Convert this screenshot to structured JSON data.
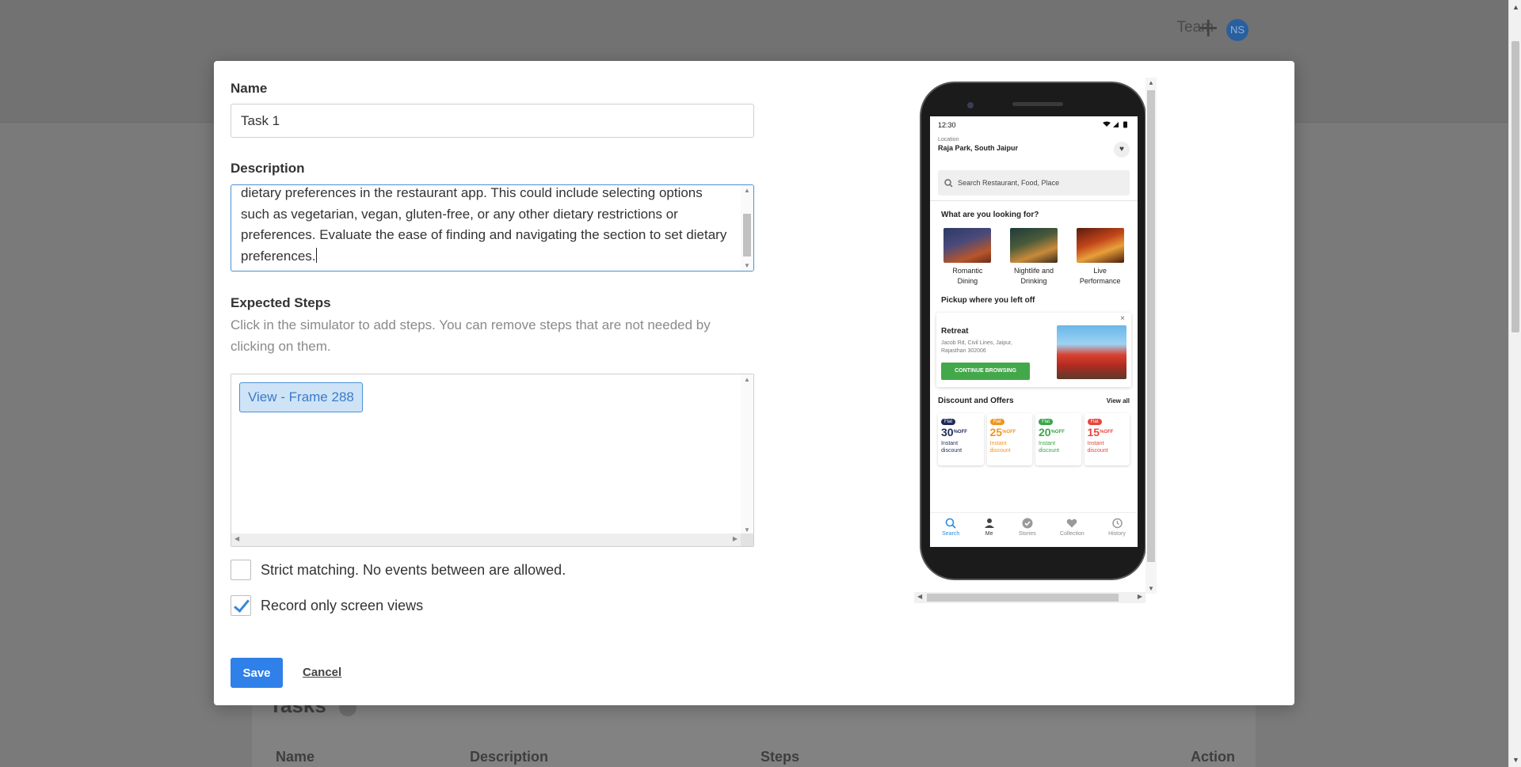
{
  "background": {
    "header": {
      "team_label": "Team",
      "plus_symbol": "+",
      "avatar_initials": "NS"
    },
    "tasks": {
      "title": "Tasks",
      "columns": [
        "Name",
        "Description",
        "Steps",
        "Action"
      ]
    }
  },
  "modal": {
    "name_label": "Name",
    "name_value": "Task 1",
    "description_label": "Description",
    "description_visible_text": "dietary preferences in the restaurant app. This could include selecting options such as vegetarian, vegan, gluten-free, or any other dietary restrictions or preferences. Evaluate the ease of finding and navigating the section to set dietary preferences.",
    "steps_label": "Expected Steps",
    "steps_hint": "Click in the simulator to add steps. You can remove steps that are not needed by clicking on them.",
    "steps": [
      "View - Frame 288"
    ],
    "strict_label": "Strict matching. No events between are allowed.",
    "strict_checked": false,
    "record_label": "Record only screen views",
    "record_checked": true,
    "save_label": "Save",
    "cancel_label": "Cancel"
  },
  "simulator": {
    "status_time": "12:30",
    "location_caption": "Location",
    "location_name": "Raja Park, South Jaipur",
    "search_placeholder": "Search Restaurant, Food, Place",
    "looking_for_title": "What are you looking for?",
    "categories": [
      {
        "label_line1": "Romantic",
        "label_line2": "Dining"
      },
      {
        "label_line1": "Nightlife and",
        "label_line2": "Drinking"
      },
      {
        "label_line1": "Live",
        "label_line2": "Performance"
      }
    ],
    "pickup_title": "Pickup where you left off",
    "pickup": {
      "close": "×",
      "name": "Retreat",
      "address_line1": "Jacob Rd, Civil Lines, Jaipur,",
      "address_line2": "Rajasthan 302006",
      "button": "CONTINUE BROWSING"
    },
    "offers_title": "Discount and Offers",
    "view_all": "View all",
    "offers": [
      {
        "flat": "Flat",
        "value": "30",
        "pct": "%",
        "off": "OFF",
        "line1": "Instant",
        "line2": "discount",
        "color": "#1f2a5a"
      },
      {
        "flat": "Flat",
        "value": "25",
        "pct": "%",
        "off": "OFF",
        "line1": "Instant",
        "line2": "discount",
        "color": "#f0961e"
      },
      {
        "flat": "Flat",
        "value": "20",
        "pct": "%",
        "off": "OFF",
        "line1": "Instant",
        "line2": "discount",
        "color": "#3aa64a"
      },
      {
        "flat": "Flat",
        "value": "15",
        "pct": "%",
        "off": "OFF",
        "line1": "Instant",
        "line2": "discount",
        "color": "#e8453c"
      }
    ],
    "nav": [
      "Search",
      "Me",
      "Stories",
      "Collection",
      "History"
    ]
  },
  "colors": {
    "accent": "#2f80e8",
    "chip_bg": "#cfe3f7",
    "green": "#43a84a"
  }
}
